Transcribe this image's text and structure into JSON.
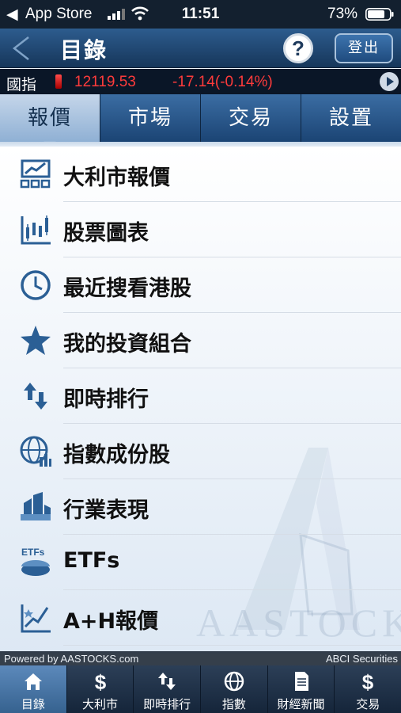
{
  "status_bar": {
    "back_glyph": "◀",
    "carrier": "App Store",
    "time": "11:51",
    "battery": "73%"
  },
  "header": {
    "title": "目錄",
    "help": "?",
    "logout": "登出"
  },
  "ticker": {
    "name": "國指",
    "price": "12119.53",
    "change": "-17.14(-0.14%)"
  },
  "tabs": [
    {
      "label": "報價",
      "active": true
    },
    {
      "label": "市場",
      "active": false
    },
    {
      "label": "交易",
      "active": false
    },
    {
      "label": "設置",
      "active": false
    }
  ],
  "menu": [
    {
      "label": "大利市報價",
      "icon": "quote-chart-icon"
    },
    {
      "label": "股票圖表",
      "icon": "candlestick-icon"
    },
    {
      "label": "最近搜看港股",
      "icon": "clock-icon"
    },
    {
      "label": "我的投資組合",
      "icon": "star-icon"
    },
    {
      "label": "即時排行",
      "icon": "sort-arrows-icon"
    },
    {
      "label": "指數成份股",
      "icon": "globe-chart-icon"
    },
    {
      "label": "行業表現",
      "icon": "buildings-icon"
    },
    {
      "label": "ETFs",
      "icon": "etf-pie-icon"
    },
    {
      "label": "A+H報價",
      "icon": "ah-chart-icon"
    }
  ],
  "watermark": "AASTOCKS",
  "powered": {
    "left": "Powered by AASTOCKS.com",
    "right": "ABCI Securities"
  },
  "bottom_nav": [
    {
      "label": "目錄",
      "icon": "home-icon",
      "active": true
    },
    {
      "label": "大利市",
      "icon": "dollar-icon",
      "active": false
    },
    {
      "label": "即時排行",
      "icon": "sort-arrows-icon",
      "active": false
    },
    {
      "label": "指數",
      "icon": "globe-icon",
      "active": false
    },
    {
      "label": "財經新聞",
      "icon": "document-icon",
      "active": false
    },
    {
      "label": "交易",
      "icon": "dollar-icon",
      "active": false
    }
  ],
  "colors": {
    "accent": "#2a5b8f",
    "down": "#ff3b3b",
    "icon": "#2b5f95"
  }
}
